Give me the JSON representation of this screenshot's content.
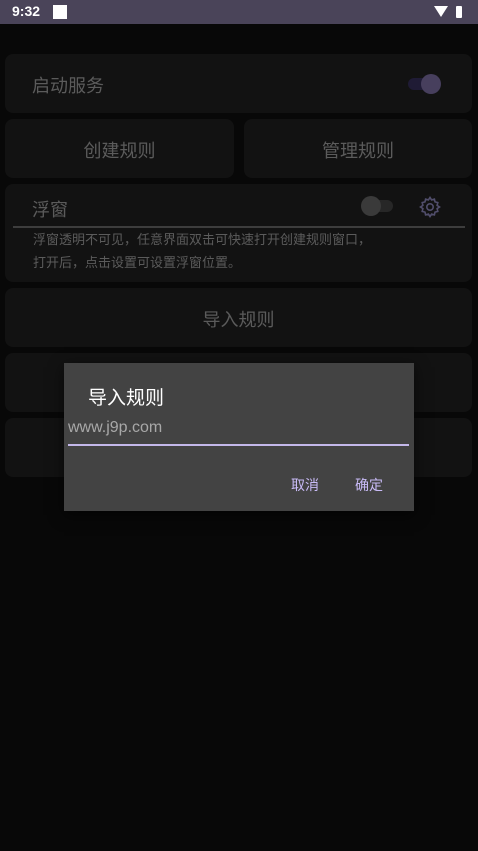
{
  "status_bar": {
    "time": "9:32"
  },
  "service": {
    "label": "启动服务",
    "enabled": true
  },
  "rules": {
    "create_label": "创建规则",
    "manage_label": "管理规则",
    "import_label": "导入规则"
  },
  "float_window": {
    "label": "浮窗",
    "enabled": false,
    "description_line1": "浮窗透明不可见，任意界面双击可快速打开创建规则窗口，",
    "description_line2": "打开后，点击设置可设置浮窗位置。"
  },
  "dialog": {
    "title": "导入规则",
    "input_value": "www.j9p.com",
    "cancel_label": "取消",
    "confirm_label": "确定"
  },
  "icons": {
    "settings": "gear-icon",
    "wifi": "wifi-icon",
    "battery": "battery-icon",
    "notification": "notification-icon"
  },
  "colors": {
    "accent": "#c9bbf7",
    "status_bar": "#4a4459",
    "card": "#1c1c1c",
    "background": "#0d0d0d"
  }
}
